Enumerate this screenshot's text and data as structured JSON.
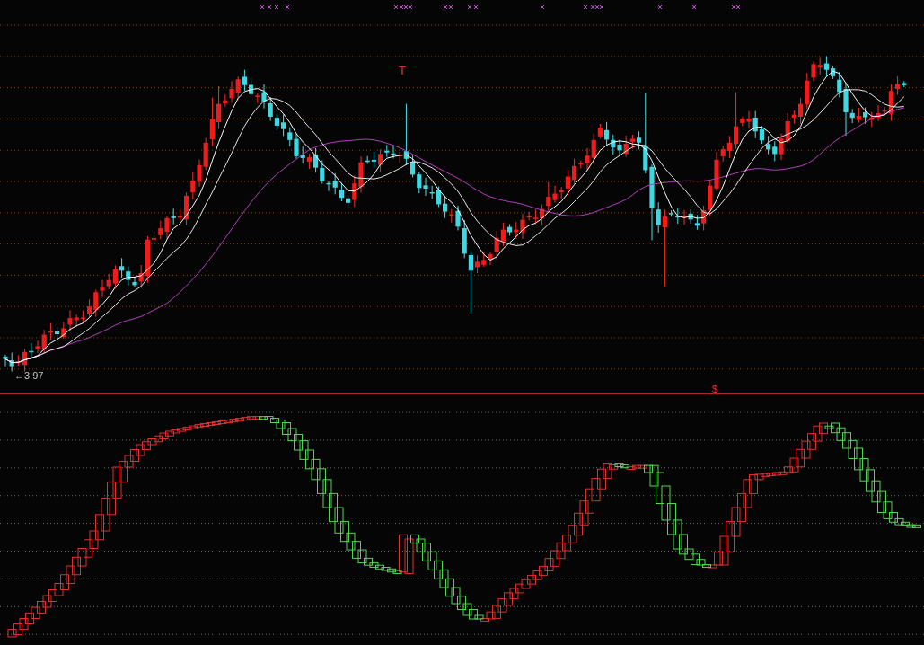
{
  "price_panel": {
    "low_price_label": "←3.97",
    "top_marker": "T"
  },
  "indicator_panel": {
    "marker": "$"
  }
}
